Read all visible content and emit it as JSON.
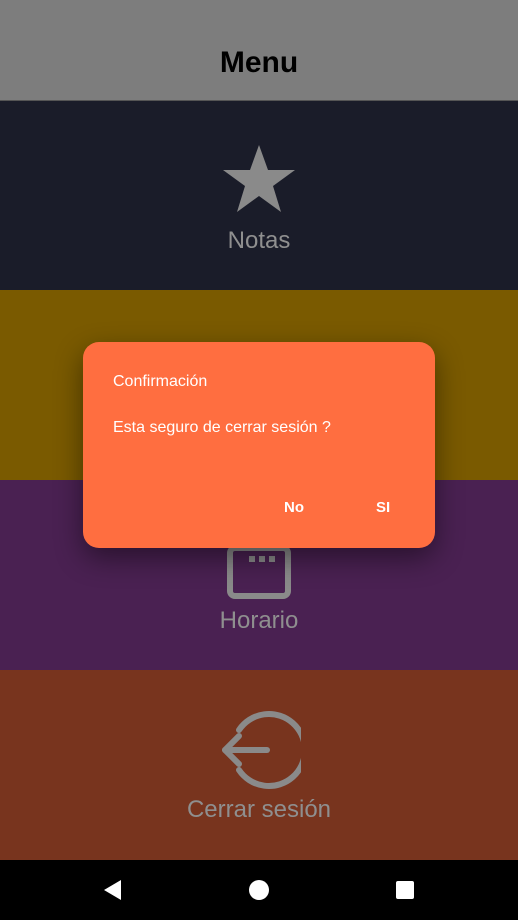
{
  "header": {
    "title": "Menu"
  },
  "tiles": [
    {
      "label": "Notas",
      "icon": "star-icon",
      "color": "#1a1c29"
    },
    {
      "label": "",
      "icon": "",
      "color": "#7a5a00"
    },
    {
      "label": "Horario",
      "icon": "calendar-icon",
      "color": "#4a2152"
    },
    {
      "label": "Cerrar sesión",
      "icon": "logout-icon",
      "color": "#78341e"
    }
  ],
  "dialog": {
    "title": "Confirmación",
    "message": "Esta seguro de cerrar sesión ?",
    "negative_label": "No",
    "positive_label": "SI",
    "color": "#ff6e40"
  },
  "navbar": {
    "back_icon": "back-triangle-icon",
    "home_icon": "home-circle-icon",
    "recents_icon": "recents-square-icon"
  }
}
